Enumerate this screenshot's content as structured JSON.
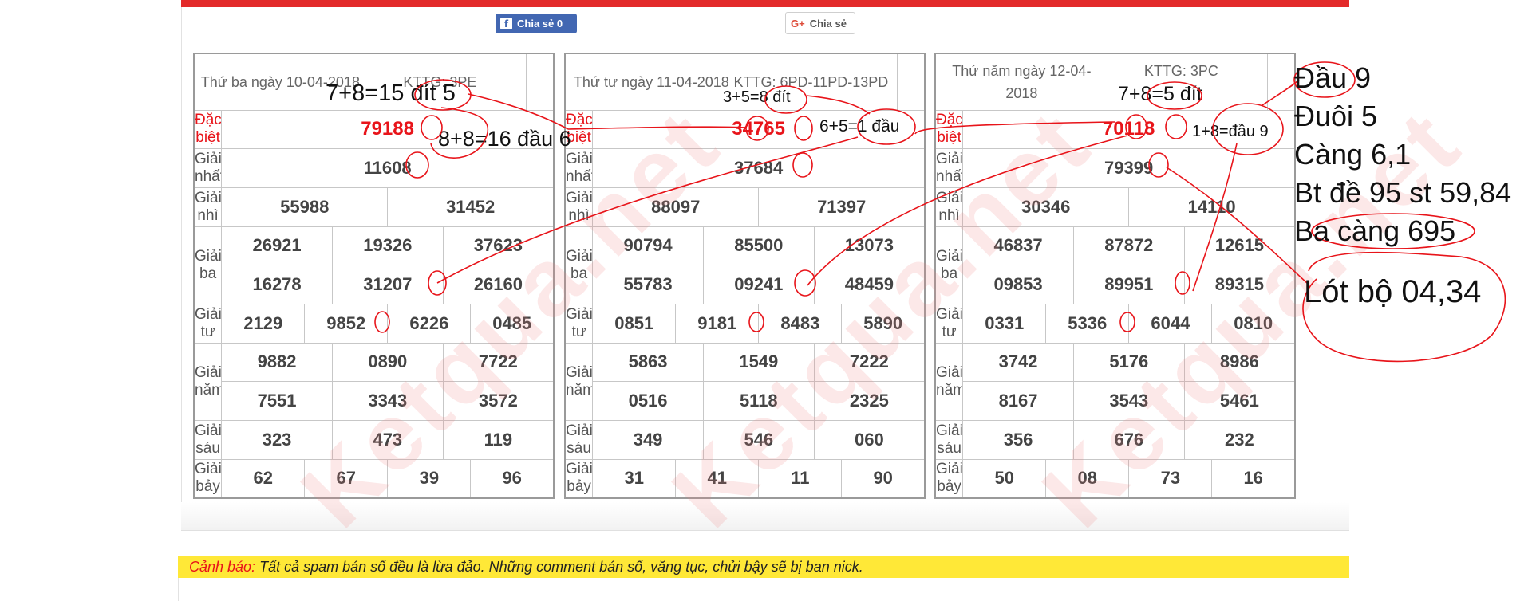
{
  "share": {
    "facebook_label": "Chia sẻ",
    "facebook_count": "0",
    "google_label": "Chia sẻ"
  },
  "results": [
    {
      "date": "Thứ ba ngày 10-04-2018",
      "kttg": "KTTG: 3PE",
      "special": "79188",
      "first": "11608",
      "second": [
        "55988",
        "31452"
      ],
      "third": [
        "26921",
        "19326",
        "37623",
        "16278",
        "31207",
        "26160"
      ],
      "fourth": [
        "2129",
        "9852",
        "6226",
        "0485"
      ],
      "fifth": [
        "9882",
        "0890",
        "7722",
        "7551",
        "3343",
        "3572"
      ],
      "sixth": [
        "323",
        "473",
        "119"
      ],
      "seventh": [
        "62",
        "67",
        "39",
        "96"
      ]
    },
    {
      "date": "Thứ tư ngày 11-04-2018",
      "kttg": "KTTG: 6PD-11PD-13PD",
      "special": "34765",
      "first": "37684",
      "second": [
        "88097",
        "71397"
      ],
      "third": [
        "90794",
        "85500",
        "13073",
        "55783",
        "09241",
        "48459"
      ],
      "fourth": [
        "0851",
        "9181",
        "8483",
        "5890"
      ],
      "fifth": [
        "5863",
        "1549",
        "7222",
        "0516",
        "5118",
        "2325"
      ],
      "sixth": [
        "349",
        "546",
        "060"
      ],
      "seventh": [
        "31",
        "41",
        "11",
        "90"
      ]
    },
    {
      "date": "Thứ năm ngày 12-04-2018",
      "kttg": "KTTG: 3PC",
      "special": "70118",
      "first": "79399",
      "second": [
        "30346",
        "14110"
      ],
      "third": [
        "46837",
        "87872",
        "12615",
        "09853",
        "89951",
        "89315"
      ],
      "fourth": [
        "0331",
        "5336",
        "6044",
        "0810"
      ],
      "fifth": [
        "3742",
        "5176",
        "8986",
        "8167",
        "3543",
        "5461"
      ],
      "sixth": [
        "356",
        "676",
        "232"
      ],
      "seventh": [
        "50",
        "08",
        "73",
        "16"
      ]
    }
  ],
  "labels": {
    "special": "Đặc biệt",
    "first": "Giải nhất",
    "second": "Giải nhì",
    "third": "Giải ba",
    "fourth": "Giải tư",
    "fifth": "Giải năm",
    "sixth": "Giải sáu",
    "seventh": "Giải bảy"
  },
  "watermark": "Ketqua.net",
  "annotations": {
    "a1": "7+8=15 đít 5",
    "a2": "8+8=16 đầu 6",
    "a3": "3+5=8 đít",
    "a4": "6+5=1 đầu",
    "a5": "7+8=5 đít",
    "a6": "1+8=đầu 9"
  },
  "notes": [
    "Đầu 9",
    "Đuôi 5",
    "Càng 6,1",
    "Bt đề 95 st 59,84",
    "Ba càng 695",
    "Lót bộ 04,34"
  ],
  "warning": {
    "label": "Cảnh báo:",
    "text": " Tất cả spam bán số đều là lừa đảo. Những comment bán số, văng tục, chửi bậy sẽ bị ban nick."
  },
  "colors": {
    "accent_red": "#e32a2a",
    "warning_yellow": "#ffe837",
    "facebook_blue": "#4267b2",
    "ink_red": "#e8141a"
  }
}
